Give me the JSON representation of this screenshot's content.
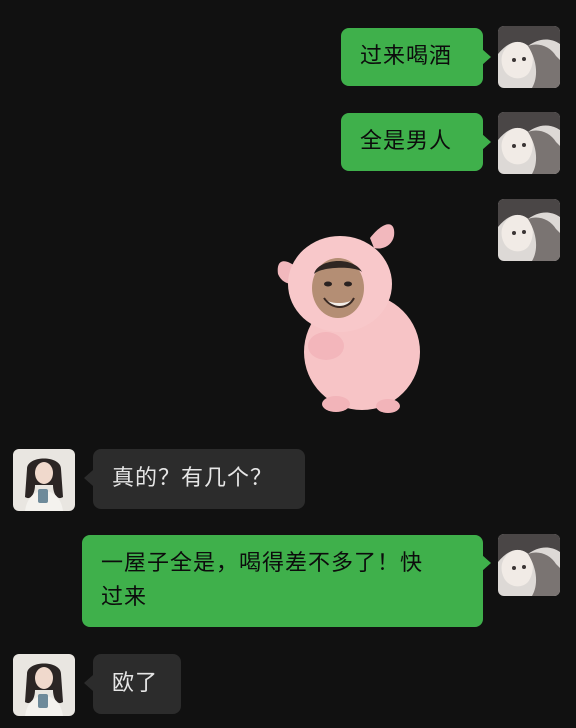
{
  "messages": [
    {
      "sender": "me",
      "type": "text",
      "text": "过来喝酒"
    },
    {
      "sender": "me",
      "type": "text",
      "text": "全是男人"
    },
    {
      "sender": "me",
      "type": "sticker",
      "sticker": "pig-face-sticker"
    },
    {
      "sender": "other",
      "type": "text",
      "text": "真的？有几个？"
    },
    {
      "sender": "me",
      "type": "text",
      "line1": "一屋子全是，喝得差不多了！快",
      "line2": "过来"
    },
    {
      "sender": "other",
      "type": "text",
      "text": "欧了"
    }
  ],
  "colors": {
    "background": "#111111",
    "outgoing_bubble": "#3fb04b",
    "incoming_bubble": "#2c2c2c"
  }
}
